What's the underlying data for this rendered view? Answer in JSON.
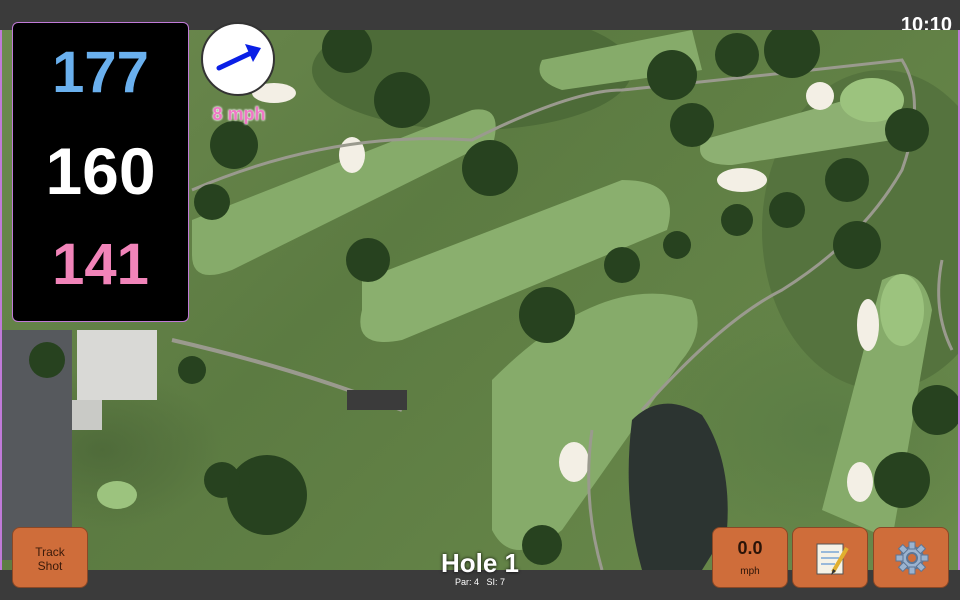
{
  "status": {
    "time": "10:10"
  },
  "yardages": {
    "back": "177",
    "middle": "160",
    "front": "141"
  },
  "wind": {
    "speed_label": "8 mph",
    "icon": "arrow-icon",
    "color": "#ef78c5"
  },
  "hole": {
    "title": "Hole 1",
    "par_label": "Par: 4",
    "si_label": "SI: 7"
  },
  "buttons": {
    "track_line1": "Track",
    "track_line2": "Shot",
    "speed_value": "0.0",
    "speed_unit": "mph",
    "notes_icon": "notepad-icon",
    "settings_icon": "gear-icon"
  },
  "colors": {
    "button": "#cf6d3a",
    "back_yardage": "#6ab0ee",
    "front_yardage": "#f184b9",
    "accent_border": "#c07ad8"
  }
}
